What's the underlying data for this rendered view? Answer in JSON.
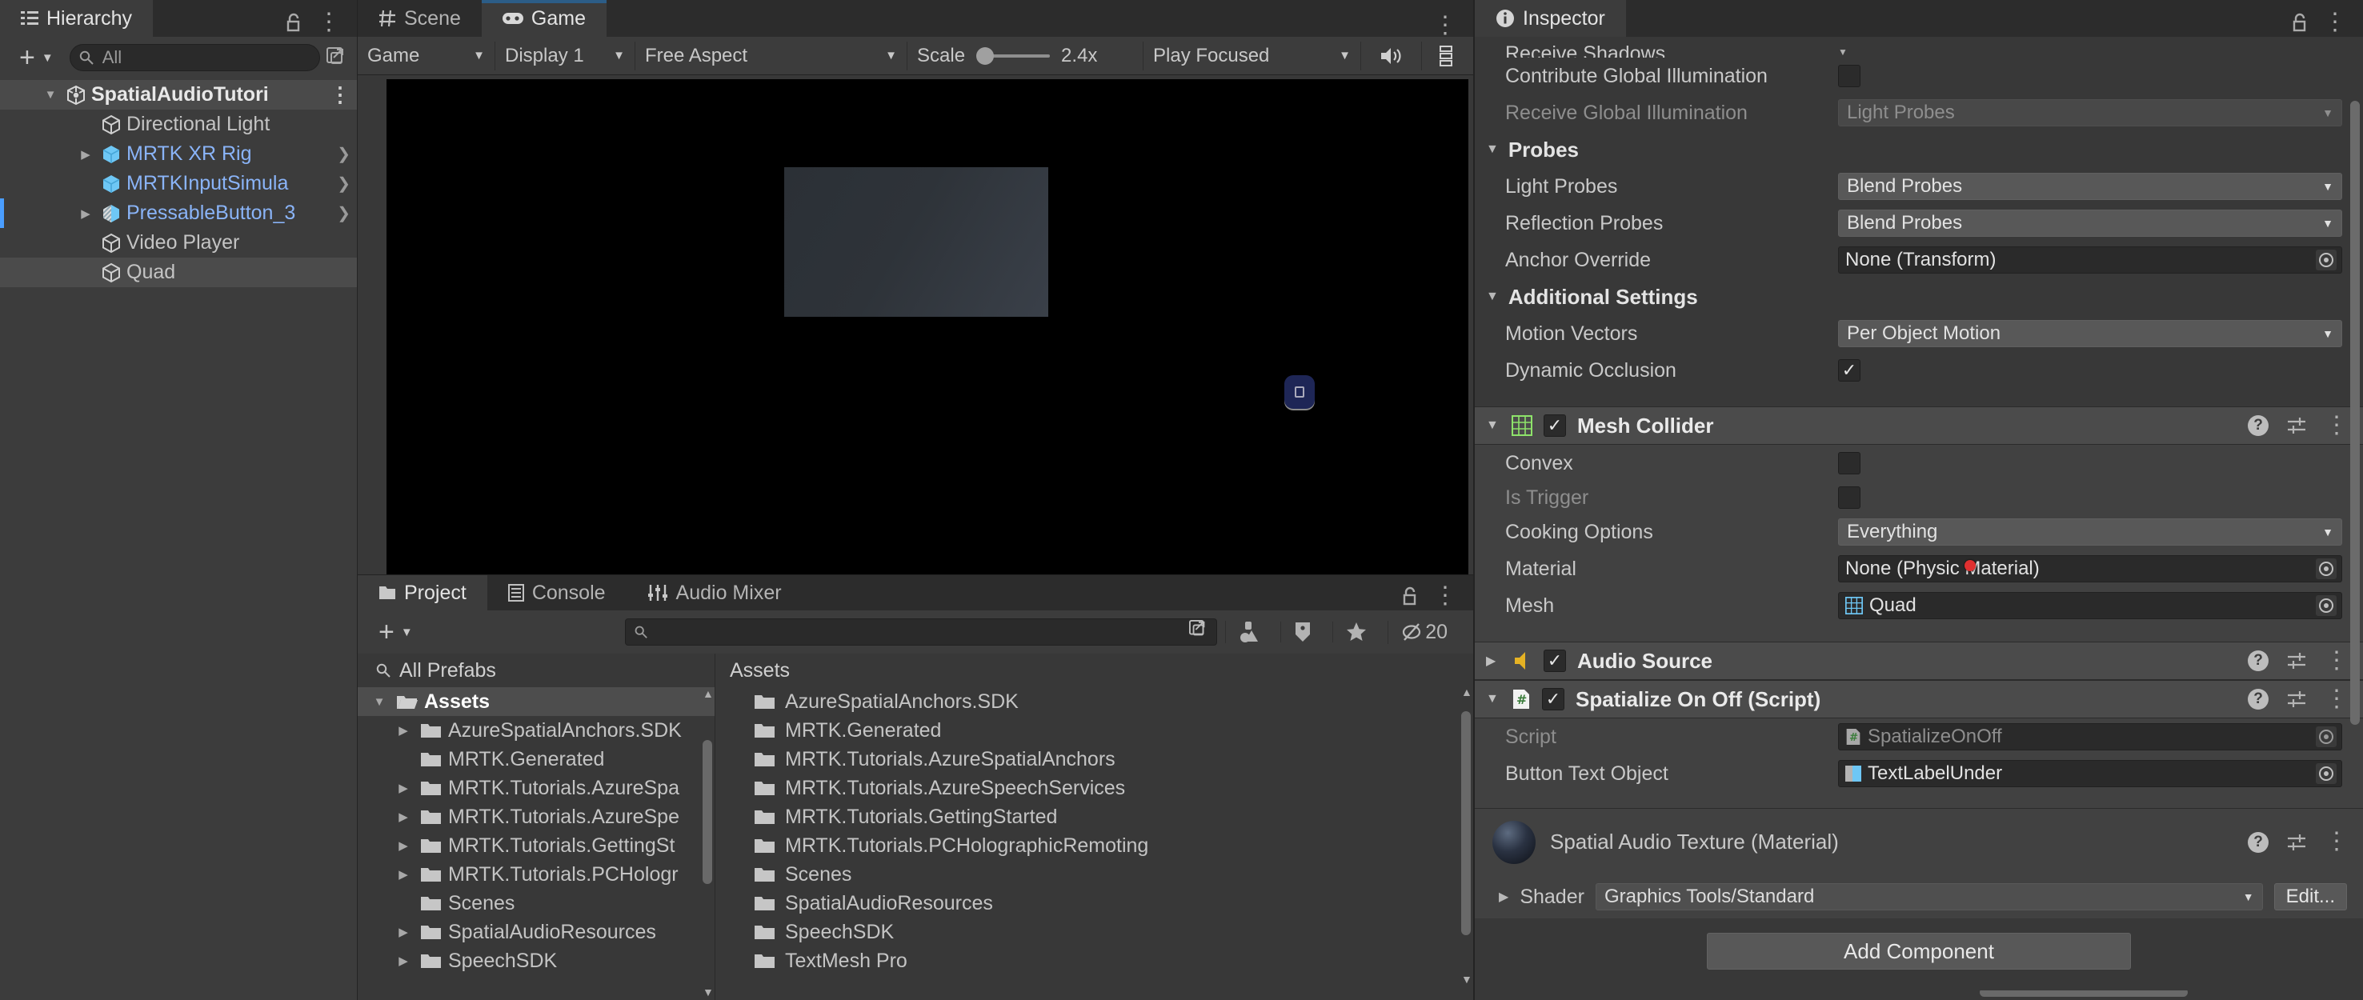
{
  "hierarchy": {
    "tab_label": "Hierarchy",
    "search_placeholder": "All",
    "create_label": "+",
    "items": [
      {
        "label": "SpatialAudioTutori",
        "indent": 0,
        "expanded": true,
        "kind": "root",
        "has_children": true,
        "prefab": false,
        "overflow": true
      },
      {
        "label": "Directional Light",
        "indent": 1,
        "expanded": false,
        "kind": "go",
        "has_children": false,
        "prefab": false
      },
      {
        "label": "MRTK XR Rig",
        "indent": 1,
        "expanded": false,
        "kind": "prefab",
        "has_children": true,
        "prefab": true
      },
      {
        "label": "MRTKInputSimula",
        "indent": 1,
        "expanded": false,
        "kind": "prefab",
        "has_children": false,
        "prefab": true
      },
      {
        "label": "PressableButton_3",
        "indent": 1,
        "expanded": false,
        "kind": "prefab-variant",
        "has_children": true,
        "prefab": true,
        "marker": true
      },
      {
        "label": "Video Player",
        "indent": 1,
        "expanded": false,
        "kind": "go",
        "has_children": false,
        "prefab": false
      },
      {
        "label": "Quad",
        "indent": 1,
        "expanded": false,
        "kind": "go",
        "has_children": false,
        "prefab": false,
        "selected": true
      }
    ]
  },
  "center": {
    "tabs": [
      {
        "label": "Scene",
        "icon": "grid-icon",
        "active": false
      },
      {
        "label": "Game",
        "icon": "gamepad-icon",
        "active": true
      }
    ],
    "toolbar": {
      "view_mode": "Game",
      "display": "Display 1",
      "aspect": "Free Aspect",
      "scale_label": "Scale",
      "scale_value": "2.4x",
      "play_mode": "Play Focused",
      "mute_icon": "speaker-icon",
      "stats_icon": "stats-icon"
    }
  },
  "project": {
    "tabs": [
      {
        "label": "Project",
        "icon": "folder-icon",
        "active": true
      },
      {
        "label": "Console",
        "icon": "console-icon",
        "active": false
      },
      {
        "label": "Audio Mixer",
        "icon": "mixer-icon",
        "active": false
      }
    ],
    "create_label": "+",
    "search_placeholder": "",
    "hidden_count": "20",
    "favorites": [
      {
        "label": "All Prefabs",
        "icon": "search-icon"
      }
    ],
    "tree": [
      {
        "label": "Assets",
        "indent": 0,
        "expanded": true,
        "selected": true,
        "has_children": true,
        "open_folder": true
      },
      {
        "label": "AzureSpatialAnchors.SDK",
        "indent": 1,
        "has_children": true
      },
      {
        "label": "MRTK.Generated",
        "indent": 1,
        "has_children": false
      },
      {
        "label": "MRTK.Tutorials.AzureSpa",
        "indent": 1,
        "has_children": true
      },
      {
        "label": "MRTK.Tutorials.AzureSpe",
        "indent": 1,
        "has_children": true
      },
      {
        "label": "MRTK.Tutorials.GettingSt",
        "indent": 1,
        "has_children": true
      },
      {
        "label": "MRTK.Tutorials.PCHologr",
        "indent": 1,
        "has_children": true
      },
      {
        "label": "Scenes",
        "indent": 1,
        "has_children": false
      },
      {
        "label": "SpatialAudioResources",
        "indent": 1,
        "has_children": true
      },
      {
        "label": "SpeechSDK",
        "indent": 1,
        "has_children": true
      }
    ],
    "breadcrumb": "Assets",
    "assets": [
      "AzureSpatialAnchors.SDK",
      "MRTK.Generated",
      "MRTK.Tutorials.AzureSpatialAnchors",
      "MRTK.Tutorials.AzureSpeechServices",
      "MRTK.Tutorials.GettingStarted",
      "MRTK.Tutorials.PCHolographicRemoting",
      "Scenes",
      "SpatialAudioResources",
      "SpeechSDK",
      "TextMesh Pro"
    ]
  },
  "inspector": {
    "tab_label": "Inspector",
    "renderer_props": [
      {
        "label": "Receive Shadows",
        "type": "clipped",
        "value": "",
        "dim": false
      },
      {
        "label": "Contribute Global Illumination",
        "type": "checkbox",
        "checked": false,
        "dim": false
      },
      {
        "label": "Receive Global Illumination",
        "type": "dropdown",
        "value": "Light Probes",
        "dim": true
      }
    ],
    "probes": {
      "title": "Probes",
      "rows": [
        {
          "label": "Light Probes",
          "type": "dropdown",
          "value": "Blend Probes"
        },
        {
          "label": "Reflection Probes",
          "type": "dropdown",
          "value": "Blend Probes"
        },
        {
          "label": "Anchor Override",
          "type": "object",
          "value": "None (Transform)"
        }
      ]
    },
    "additional_settings": {
      "title": "Additional Settings",
      "rows": [
        {
          "label": "Motion Vectors",
          "type": "dropdown",
          "value": "Per Object Motion"
        },
        {
          "label": "Dynamic Occlusion",
          "type": "checkbox",
          "checked": true
        }
      ]
    },
    "mesh_collider": {
      "title": "Mesh Collider",
      "enabled": true,
      "expanded": true,
      "icon": "mesh-collider-icon",
      "rows": [
        {
          "label": "Convex",
          "type": "checkbox",
          "checked": false,
          "dim": false
        },
        {
          "label": "Is Trigger",
          "type": "checkbox",
          "checked": false,
          "dim": true
        },
        {
          "label": "Cooking Options",
          "type": "dropdown",
          "value": "Everything"
        },
        {
          "label": "Material",
          "type": "object",
          "value": "None (Physic Material)"
        },
        {
          "label": "Mesh",
          "type": "object",
          "value": "Quad",
          "icon": "mesh-icon"
        }
      ]
    },
    "audio_source": {
      "title": "Audio Source",
      "enabled": true,
      "expanded": false,
      "icon": "audio-source-icon"
    },
    "spatialize_script": {
      "title": "Spatialize On Off (Script)",
      "enabled": true,
      "expanded": true,
      "icon": "script-icon",
      "rows": [
        {
          "label": "Script",
          "type": "object",
          "value": "SpatializeOnOff",
          "dim": true,
          "icon": "script-icon"
        },
        {
          "label": "Button Text Object",
          "type": "object",
          "value": "TextLabelUnder",
          "dim": false,
          "icon": "prefab-icon"
        }
      ]
    },
    "material": {
      "title": "Spatial Audio Texture (Material)",
      "shader_label": "Shader",
      "shader_value": "Graphics Tools/Standard",
      "edit_label": "Edit..."
    },
    "add_component_label": "Add Component"
  },
  "colors": {
    "accent_blue": "#4a9eff",
    "prefab_blue": "#8ab4f8",
    "panel_bg": "#383838",
    "header_bg": "#4b4b4b",
    "collider_green": "#8ee36a",
    "audio_yellow": "#e5b224",
    "cursor_red": "#e03030"
  }
}
